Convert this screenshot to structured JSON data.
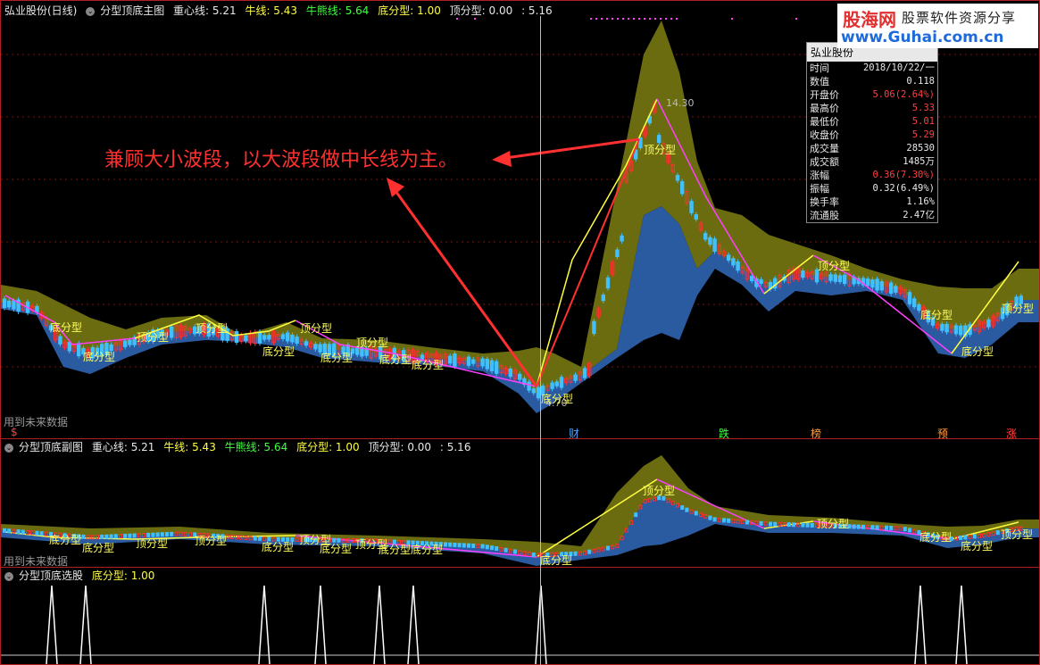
{
  "main": {
    "stock": "弘业股份(日线)",
    "indicator": "分型顶底主图",
    "zhongxin_label": "重心线: 5.21",
    "niu_label": "牛线: 5.43",
    "niuxiong_label": "牛熊线: 5.64",
    "difenxing_label": "底分型: 1.00",
    "dingfenxing_label": "顶分型: 0.00",
    "extra_label": ": 5.16",
    "future_text": "用到未来数据",
    "annotation": "兼顾大小波段，以大波段做中长线为主。",
    "peak_price": "14.30",
    "low_price": "4.70",
    "ding_label": "顶分型",
    "di_label": "底分型"
  },
  "sub": {
    "indicator": "分型顶底副图",
    "zhongxin_label": "重心线: 5.21",
    "niu_label": "牛线: 5.43",
    "niuxiong_label": "牛熊线: 5.64",
    "difenxing_label": "底分型: 1.00",
    "dingfenxing_label": "顶分型: 0.00",
    "extra_label": ": 5.16",
    "future_text": "用到未来数据"
  },
  "select": {
    "indicator": "分型顶底选股",
    "difenxing_label": "底分型: 1.00"
  },
  "events": [
    {
      "text": "$",
      "color": "#ff4040"
    },
    {
      "text": "财",
      "color": "#4aa0ff"
    },
    {
      "text": "跌",
      "color": "#40ff40"
    },
    {
      "text": "榜",
      "color": "#ffa040"
    },
    {
      "text": "预",
      "color": "#ffa040"
    },
    {
      "text": "涨",
      "color": "#ff4040"
    }
  ],
  "infobox": {
    "title": "弘业股份",
    "rows": [
      {
        "k": "时间",
        "v": "2018/10/22/一",
        "red": false
      },
      {
        "k": "数值",
        "v": "0.118",
        "red": false
      },
      {
        "k": "开盘价",
        "v": "5.06(2.64%)",
        "red": true
      },
      {
        "k": "最高价",
        "v": "5.33",
        "red": true
      },
      {
        "k": "最低价",
        "v": "5.01",
        "red": true
      },
      {
        "k": "收盘价",
        "v": "5.29",
        "red": true
      },
      {
        "k": "成交量",
        "v": "28530",
        "red": false
      },
      {
        "k": "成交额",
        "v": "1485万",
        "red": false
      },
      {
        "k": "涨幅",
        "v": "0.36(7.30%)",
        "red": true
      },
      {
        "k": "振幅",
        "v": "0.32(6.49%)",
        "red": false
      },
      {
        "k": "换手率",
        "v": "1.16%",
        "red": false
      },
      {
        "k": "流通股",
        "v": "2.47亿",
        "red": false
      }
    ]
  },
  "watermark": {
    "site": "股海网",
    "slogan": "股票软件资源分享",
    "url": "www.Guhai.com.cn"
  },
  "colors": {
    "border": "#b02020",
    "band_upper": "#6b6b10",
    "band_lower": "#2a5aa0",
    "up_candle": "#ff3030",
    "down_candle": "#40c0ff",
    "wave_up": "#ffff40",
    "wave_down": "#ff40ff"
  }
}
